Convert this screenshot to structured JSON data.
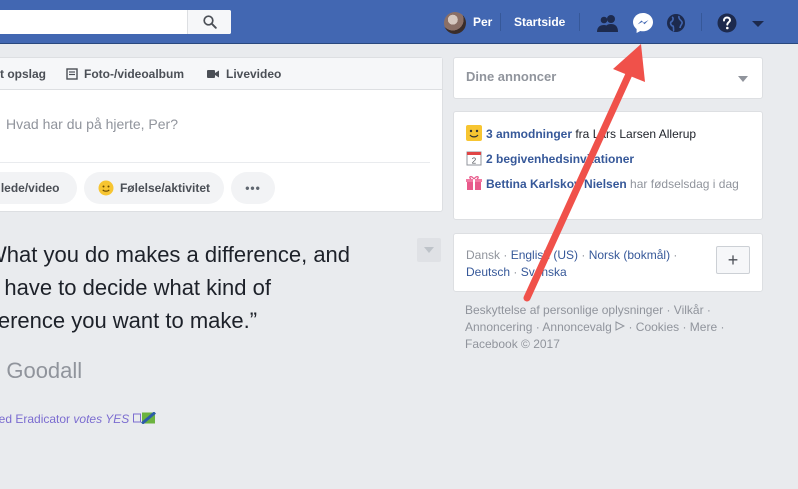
{
  "topbar": {
    "user_name": "Per",
    "home_label": "Startside",
    "icons": [
      "search-icon",
      "friends-icon",
      "messenger-icon",
      "globe-icon",
      "help-icon",
      "chevron-down-icon"
    ]
  },
  "composer": {
    "tabs": [
      "t opslag",
      "Foto-/videoalbum",
      "Livevideo"
    ],
    "placeholder": "Hvad har du på hjerte, Per?",
    "actions": [
      "llede/video",
      "Følelse/aktivitet",
      "•••"
    ]
  },
  "post": {
    "quote_lines": [
      "What you do makes a difference, and",
      "u have to decide what kind of",
      "fference you want to make.”"
    ],
    "author": "e Goodall",
    "vote_prefix": "eed Eradicator ",
    "vote_italic": "votes YES"
  },
  "right": {
    "ads_title": "Dine annoncer",
    "notifications": [
      {
        "bold": "3 anmodninger",
        "rest": " fra Lars Larsen Allerup"
      },
      {
        "bold": "2 begivenhedsinvitationer",
        "rest": ""
      },
      {
        "bold": "Bettina Karlskov Nielsen",
        "rest": " har fødselsdag i dag"
      }
    ],
    "languages_line1": [
      "Dansk",
      "English (US)",
      "Norsk (bokmål)"
    ],
    "languages_line2": [
      "Deutsch",
      "Svenska"
    ],
    "add_language": "+",
    "footer_line1": "Beskyttelse af personlige oplysninger · Vilkår ·",
    "footer_line2a": "Annoncering · Annoncevalg",
    "footer_line2b": " · Cookies · Mere ·",
    "footer_line3": "Facebook © 2017"
  },
  "colors": {
    "brand": "#4267b2",
    "link": "#365899",
    "arrow": "#f0514a"
  }
}
